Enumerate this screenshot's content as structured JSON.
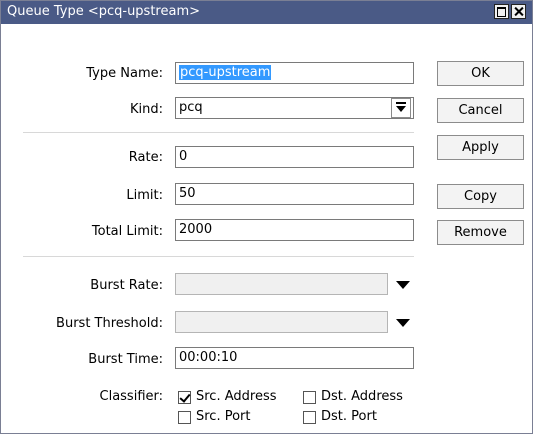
{
  "window": {
    "title": "Queue Type <pcq-upstream>"
  },
  "form": {
    "type_name": {
      "label": "Type Name:",
      "value": "pcq-upstream"
    },
    "kind": {
      "label": "Kind:",
      "value": "pcq"
    },
    "rate": {
      "label": "Rate:",
      "value": "0"
    },
    "limit": {
      "label": "Limit:",
      "value": "50"
    },
    "total_limit": {
      "label": "Total Limit:",
      "value": "2000"
    },
    "burst_rate": {
      "label": "Burst Rate:",
      "value": ""
    },
    "burst_threshold": {
      "label": "Burst Threshold:",
      "value": ""
    },
    "burst_time": {
      "label": "Burst Time:",
      "value": "00:00:10"
    },
    "classifier": {
      "label": "Classifier:",
      "options": [
        {
          "label": "Src. Address",
          "checked": true
        },
        {
          "label": "Dst. Address",
          "checked": false
        },
        {
          "label": "Src. Port",
          "checked": false
        },
        {
          "label": "Dst. Port",
          "checked": false
        }
      ]
    }
  },
  "buttons": {
    "ok": "OK",
    "cancel": "Cancel",
    "apply": "Apply",
    "copy": "Copy",
    "remove": "Remove"
  }
}
